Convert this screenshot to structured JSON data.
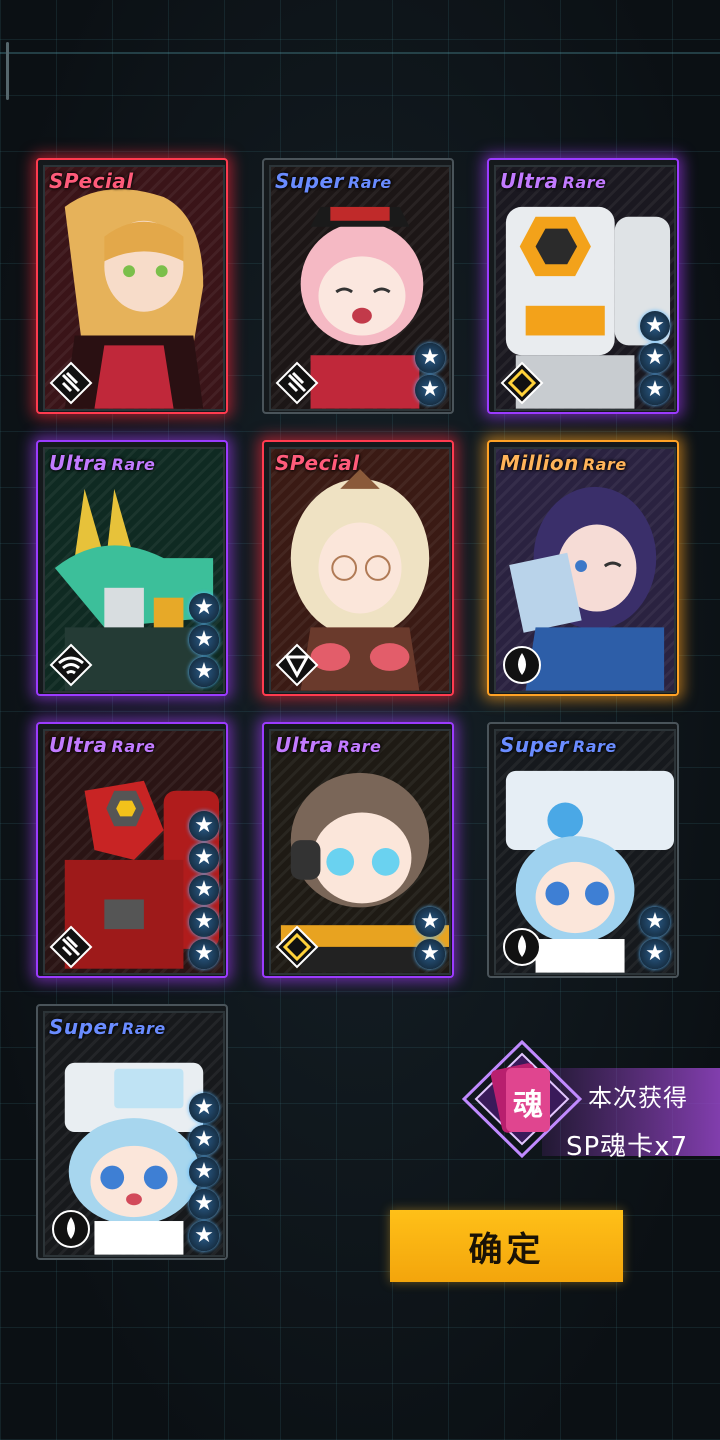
{
  "cards": [
    {
      "rarity_main": "SPecial",
      "rarity_sub": "",
      "tier": "sp",
      "stars": 0,
      "emblem": "slash-emblem-icon"
    },
    {
      "rarity_main": "Super",
      "rarity_sub": "Rare",
      "tier": "sr",
      "stars": 2,
      "emblem": "slash-emblem-icon"
    },
    {
      "rarity_main": "Ultra",
      "rarity_sub": "Rare",
      "tier": "ur",
      "stars": 3,
      "emblem": "diamond-emblem-icon"
    },
    {
      "rarity_main": "Ultra",
      "rarity_sub": "Rare",
      "tier": "ur",
      "stars": 3,
      "emblem": "wifi-emblem-icon"
    },
    {
      "rarity_main": "SPecial",
      "rarity_sub": "",
      "tier": "sp",
      "stars": 0,
      "emblem": "triangle-emblem-icon"
    },
    {
      "rarity_main": "Million",
      "rarity_sub": "Rare",
      "tier": "mr",
      "stars": 0,
      "emblem": "drop-emblem-icon"
    },
    {
      "rarity_main": "Ultra",
      "rarity_sub": "Rare",
      "tier": "ur",
      "stars": 5,
      "emblem": "slash-emblem-icon"
    },
    {
      "rarity_main": "Ultra",
      "rarity_sub": "Rare",
      "tier": "ur",
      "stars": 2,
      "emblem": "diamond-emblem-icon"
    },
    {
      "rarity_main": "Super",
      "rarity_sub": "Rare",
      "tier": "sr",
      "stars": 2,
      "emblem": "drop-emblem-icon"
    },
    {
      "rarity_main": "Super",
      "rarity_sub": "Rare",
      "tier": "sr",
      "stars": 5,
      "emblem": "drop-emblem-icon"
    }
  ],
  "reward": {
    "badge_char": "魂",
    "line1": "本次获得",
    "line2": "SP魂卡x7"
  },
  "confirm_label": "确定",
  "colors": {
    "special": "#ff3b4f",
    "ultra": "#9b3bff",
    "million": "#ffa225",
    "super": "#4a545a",
    "confirm": "#ffc018"
  }
}
